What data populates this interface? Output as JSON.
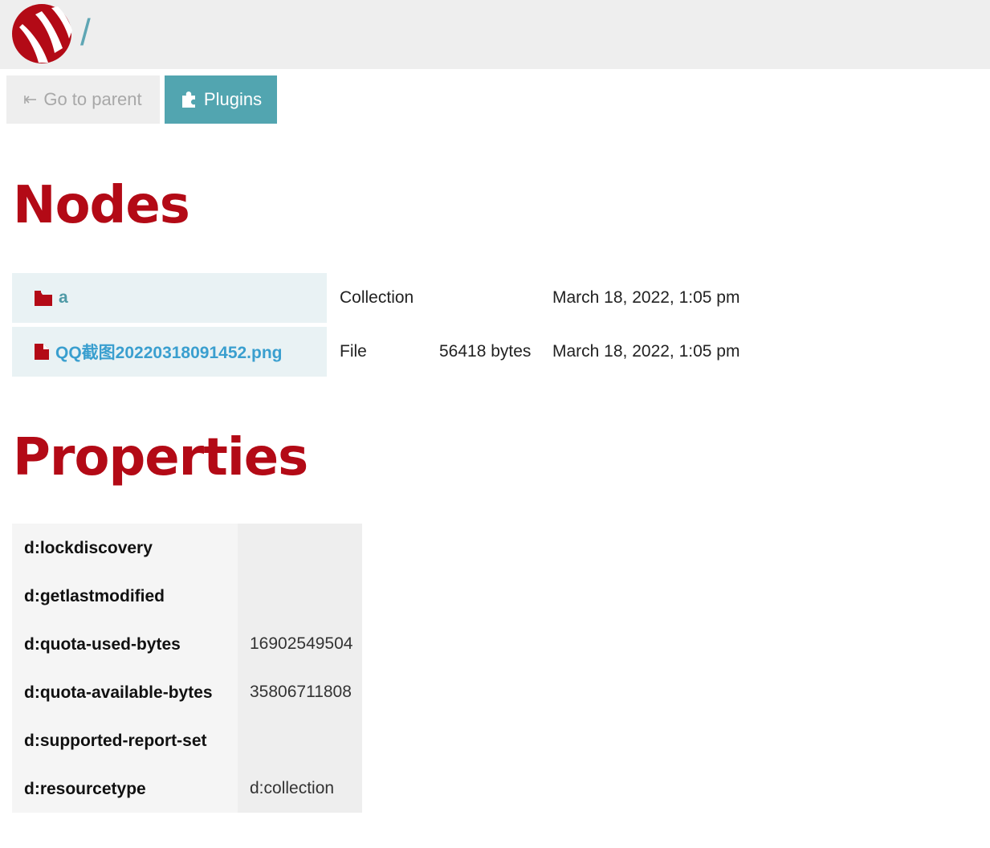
{
  "header": {
    "path": "/",
    "logo": "sabredav-logo",
    "colors": {
      "brand": "#b30a16",
      "accent": "#52a5b0"
    }
  },
  "toolbar": {
    "parent_label": "Go to parent",
    "parent_icon": "arrow-to-left-icon",
    "plugins_label": "Plugins",
    "plugins_icon": "puzzle-icon"
  },
  "nodes": {
    "title": "Nodes",
    "rows": [
      {
        "icon": "folder-icon",
        "name": "a",
        "type": "Collection",
        "size": "",
        "modified": "March 18, 2022, 1:05 pm",
        "info": ""
      },
      {
        "icon": "file-icon",
        "name": "QQ截图20220318091452.png",
        "type": "File",
        "size": "56418 bytes",
        "modified": "March 18, 2022, 1:05 pm",
        "info": "info-icon"
      }
    ]
  },
  "properties": {
    "title": "Properties",
    "rows": [
      {
        "key": "d:lockdiscovery",
        "value": ""
      },
      {
        "key": "d:getlastmodified",
        "value": ""
      },
      {
        "key": "d:quota-used-bytes",
        "value": "16902549504"
      },
      {
        "key": "d:quota-available-bytes",
        "value": "35806711808"
      },
      {
        "key": "d:supported-report-set",
        "value": ""
      },
      {
        "key": "d:resourcetype",
        "value": "d:collection"
      }
    ]
  }
}
